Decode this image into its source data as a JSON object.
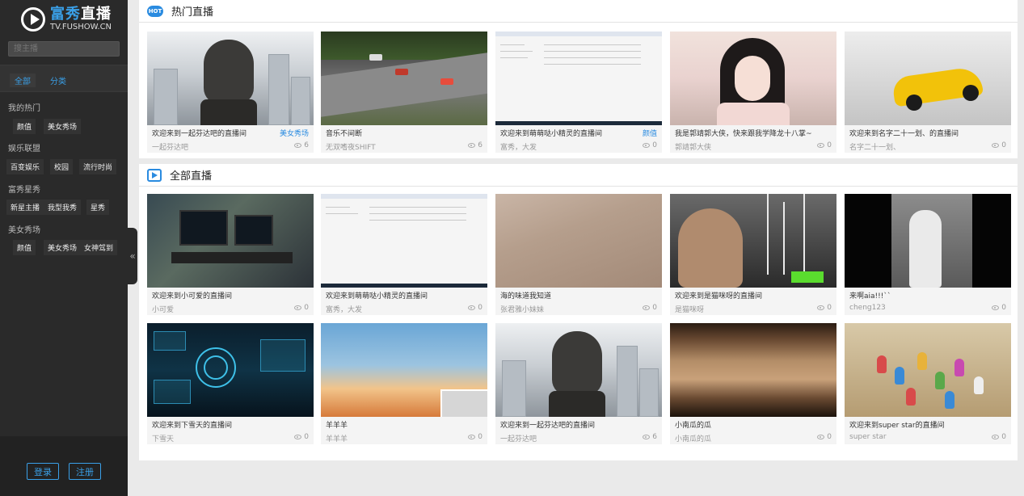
{
  "sidebar": {
    "logo": {
      "cn_a": "富秀",
      "cn_b": "直播",
      "en": "TV.FUSHOW.CN"
    },
    "search_placeholder": "搜主播",
    "tabs": [
      {
        "label": "全部"
      },
      {
        "label": "分类"
      }
    ],
    "groups": [
      {
        "title": "我的热门",
        "items": [
          "颜值",
          "美女秀场"
        ]
      },
      {
        "title": "娱乐联盟",
        "items": [
          "百变娱乐",
          "校园",
          "流行时尚"
        ]
      },
      {
        "title": "富秀星秀",
        "items": [
          "新星主播",
          "我型我秀",
          "星秀"
        ]
      },
      {
        "title": "美女秀场",
        "items": [
          "颜值",
          "美女秀场",
          "女神驾到"
        ]
      }
    ],
    "login_label": "登录",
    "register_label": "注册",
    "collapse_glyph": "«"
  },
  "hot": {
    "badge": "HOT",
    "title": "热门直播",
    "cards": [
      {
        "title": "欢迎来到一起芬达吧的直播间",
        "tag": "美女秀场",
        "host": "一起芬达吧",
        "views": "6"
      },
      {
        "title": "音乐不间断",
        "tag": "",
        "host": "无双嗜夜SHIFT",
        "views": "6"
      },
      {
        "title": "欢迎来到萌萌哒小精灵的直播间",
        "tag": "颜值",
        "host": "富秀，大发",
        "views": "0"
      },
      {
        "title": "我是郭靖郭大侠，快来跟我学降龙十八掌~",
        "tag": "",
        "host": "郭靖郭大侠",
        "views": "0"
      },
      {
        "title": "欢迎来到名字二十一划、的直播间",
        "tag": "",
        "host": "名字二十一划、",
        "views": "0"
      }
    ]
  },
  "all": {
    "title": "全部直播",
    "cards": [
      {
        "title": "欢迎来到小可爱的直播间",
        "host": "小可爱",
        "views": "0"
      },
      {
        "title": "欢迎来到萌萌哒小精灵的直播间",
        "host": "富秀，大发",
        "views": "0"
      },
      {
        "title": "海的味道我知道",
        "host": "张君雅小妹妹",
        "views": "0"
      },
      {
        "title": "欢迎来到是猫咪呀的直播间",
        "host": "是猫咪呀",
        "views": "0"
      },
      {
        "title": "来啊aia!!!``",
        "host": "cheng123",
        "views": "0"
      },
      {
        "title": "欢迎来到下雪天的直播间",
        "host": "下雪天",
        "views": "0"
      },
      {
        "title": "羊羊羊",
        "host": "羊羊羊",
        "views": "0"
      },
      {
        "title": "欢迎来到一起芬达吧的直播间",
        "host": "一起芬达吧",
        "views": "6"
      },
      {
        "title": "小南瓜的瓜",
        "host": "小南瓜的瓜",
        "views": "0"
      },
      {
        "title": "欢迎来到super star的直播间",
        "host": "super star",
        "views": "0"
      }
    ]
  },
  "colors": {
    "accent": "#2a8be0",
    "sidebar_bg": "#2a2a2a",
    "page_bg": "#eaeaea"
  }
}
